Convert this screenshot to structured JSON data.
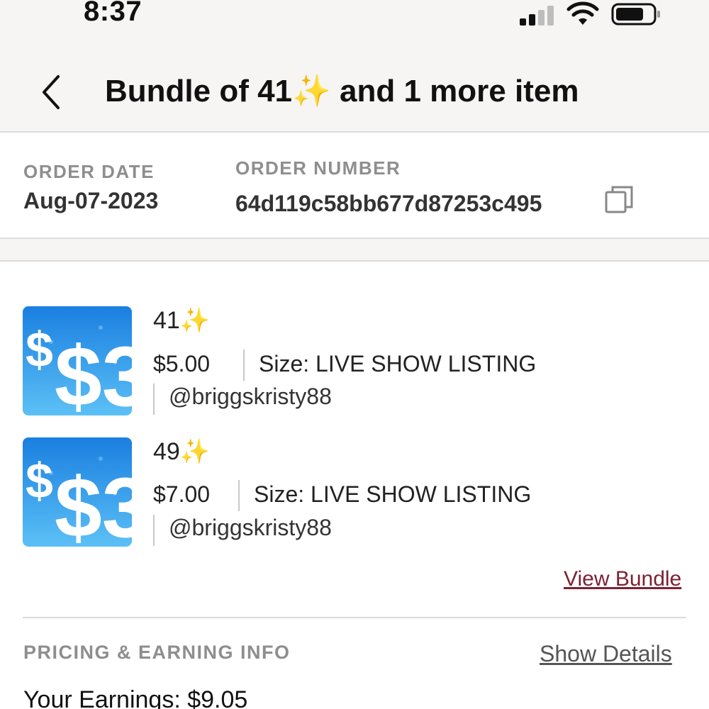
{
  "status_bar": {
    "time": "8:37",
    "signal_icon": "cellular-signal-icon",
    "wifi_icon": "wifi-icon",
    "battery_icon": "battery-icon"
  },
  "header": {
    "back_icon": "chevron-left-icon",
    "title": "Bundle of 41✨ and 1 more item"
  },
  "order": {
    "date_label": "ORDER DATE",
    "date_value": "Aug-07-2023",
    "number_label": "ORDER NUMBER",
    "number_value": "64d119c58bb677d87253c495",
    "copy_icon": "copy-icon"
  },
  "items": [
    {
      "thumb_text": "$3",
      "name": "41✨",
      "price": "$5.00",
      "size": "Size: LIVE SHOW LISTING",
      "seller": "@briggskristy88"
    },
    {
      "thumb_text": "$3",
      "name": "49✨",
      "price": "$7.00",
      "size": "Size: LIVE SHOW LISTING",
      "seller": "@briggskristy88"
    }
  ],
  "bundle": {
    "view_label": "View Bundle"
  },
  "pricing": {
    "label": "PRICING & EARNING INFO",
    "show_details": "Show Details",
    "earnings": "Your Earnings: $9.05"
  },
  "colors": {
    "accent_link": "#7b2233",
    "header_bg": "#f7f4f4",
    "label_gray": "#8e8e8e",
    "thumb_blue": "#1f8fe0"
  }
}
